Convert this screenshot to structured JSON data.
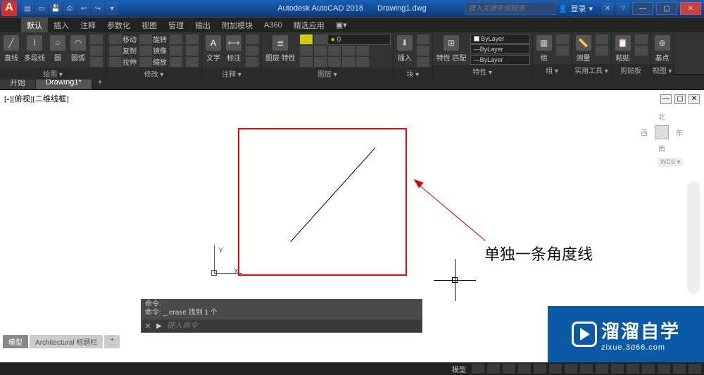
{
  "title": {
    "app_icon": "A",
    "app_name": "Autodesk AutoCAD 2018",
    "doc_name": "Drawing1.dwg",
    "search_placeholder": "键入关键字或短语",
    "login": "登录"
  },
  "menu": {
    "items": [
      "默认",
      "插入",
      "注释",
      "参数化",
      "视图",
      "管理",
      "输出",
      "附加模块",
      "A360",
      "精选应用"
    ],
    "active_index": 0
  },
  "ribbon": {
    "draw": {
      "title": "绘图 ▾",
      "line": "直线",
      "polyline": "多段线",
      "circle": "圆",
      "arc": "圆弧"
    },
    "modify": {
      "title": "修改 ▾",
      "move": "移动",
      "copy": "复制",
      "stretch": "拉伸",
      "rotate": "旋转",
      "mirror": "镜像",
      "scale": "缩放"
    },
    "annotation": {
      "title": "注释 ▾",
      "text": "文字",
      "dim": "标注"
    },
    "layers": {
      "title": "图层 ▾",
      "props": "图层\n特性",
      "current": "0"
    },
    "block": {
      "title": "块 ▾",
      "insert": "插入"
    },
    "properties": {
      "title": "特性 ▾",
      "match": "特性\n匹配",
      "bylayer1": "ByLayer",
      "bylayer2": "ByLayer",
      "bylayer3": "ByLayer"
    },
    "groups": {
      "title": "组 ▾",
      "group": "组"
    },
    "utilities": {
      "title": "实用工具 ▾",
      "measure": "测量"
    },
    "clipboard": {
      "title": "剪贴板",
      "paste": "粘贴"
    },
    "view": {
      "title": "视图 ▾",
      "base": "基点"
    }
  },
  "doctabs": {
    "start": "开始",
    "drawing": "Drawing1*",
    "add": "+"
  },
  "canvas": {
    "view_label": "[-][俯视][二维线框]",
    "ucs": {
      "x": "X",
      "y": "Y"
    },
    "viewcube": {
      "n": "北",
      "s": "南",
      "e": "东",
      "w": "西",
      "wcs": "WCS ▾"
    },
    "annotation": "单独一条角度线"
  },
  "command": {
    "hist1": "命令:",
    "hist2": "命令: _.erase 找到 1 个",
    "placeholder": "键入命令",
    "prompt": "▶"
  },
  "layouts": {
    "model": "模型",
    "arch": "Architectural 标题栏",
    "add": "+"
  },
  "status": {
    "model": "模型"
  },
  "watermark": {
    "main": "溜溜自学",
    "sub": "zixue.3d66.com"
  }
}
